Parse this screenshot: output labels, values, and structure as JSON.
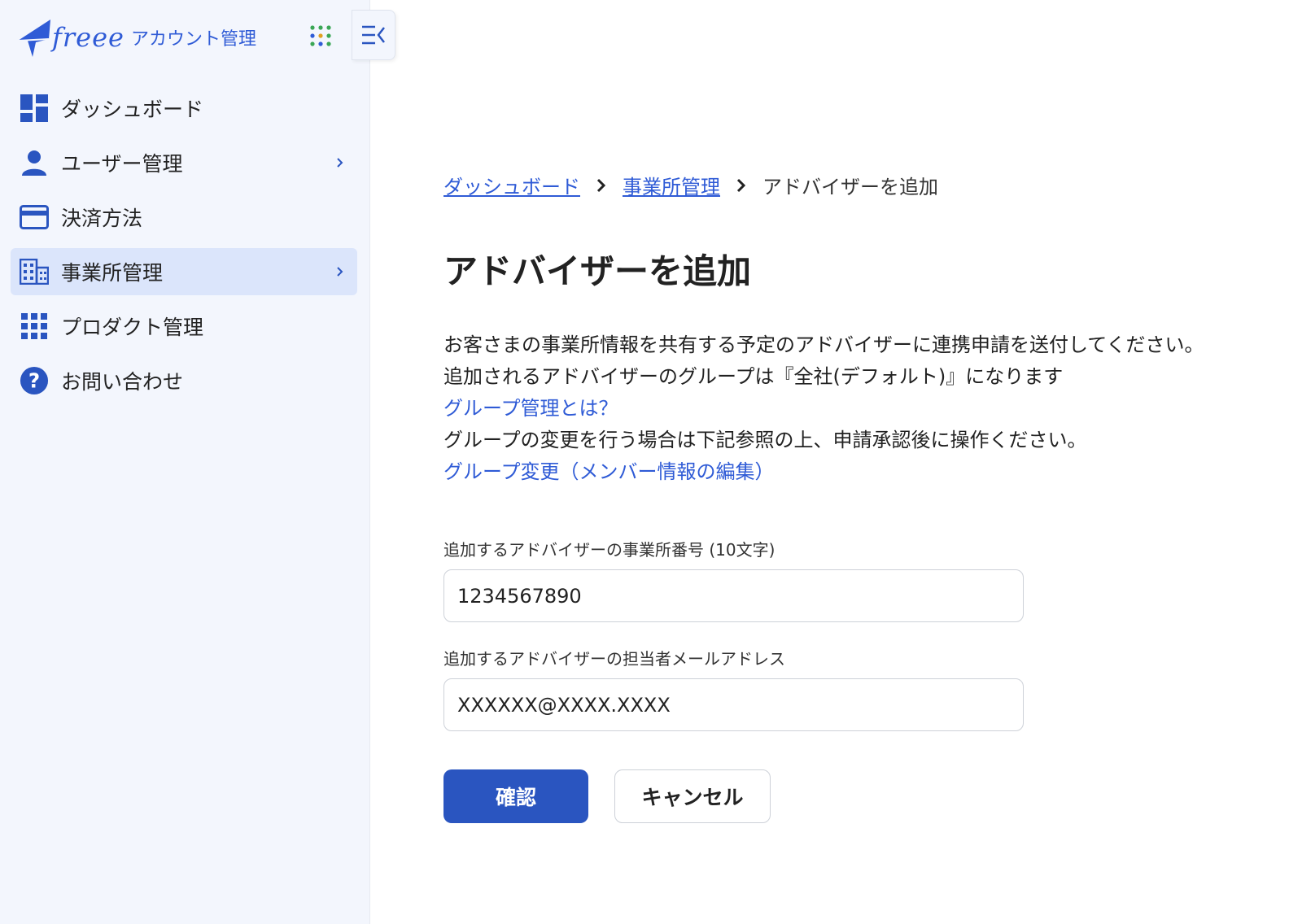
{
  "sidebar": {
    "logo_text": "freee",
    "logo_sub": "アカウント管理",
    "apps_icon": "grid-dots-icon",
    "collapse_icon": "collapse-menu-icon",
    "items": [
      {
        "label": "ダッシュボード",
        "icon": "dashboard-icon",
        "active": false,
        "has_chevron": false
      },
      {
        "label": "ユーザー管理",
        "icon": "user-icon",
        "active": false,
        "has_chevron": true
      },
      {
        "label": "決済方法",
        "icon": "credit-card-icon",
        "active": false,
        "has_chevron": false
      },
      {
        "label": "事業所管理",
        "icon": "building-icon",
        "active": true,
        "has_chevron": true
      },
      {
        "label": "プロダクト管理",
        "icon": "grid-icon",
        "active": false,
        "has_chevron": false
      },
      {
        "label": "お問い合わせ",
        "icon": "help-icon",
        "active": false,
        "has_chevron": false
      }
    ]
  },
  "breadcrumb": {
    "items": [
      "ダッシュボード",
      "事業所管理"
    ],
    "current": "アドバイザーを追加"
  },
  "page": {
    "title": "アドバイザーを追加",
    "desc_line1": "お客さまの事業所情報を共有する予定のアドバイザーに連携申請を送付してください。",
    "desc_line2": "追加されるアドバイザーのグループは『全社(デフォルト)』になります",
    "link_group_about": "グループ管理とは？",
    "desc_line3": "グループの変更を行う場合は下記参照の上、申請承認後に操作ください。",
    "link_group_change": "グループ変更（メンバー情報の編集）"
  },
  "form": {
    "office_number_label": "追加するアドバイザーの事業所番号 (10文字)",
    "office_number_value": "1234567890",
    "email_label": "追加するアドバイザーの担当者メールアドレス",
    "email_value": "XXXXXX@XXXX.XXXX",
    "confirm_label": "確認",
    "cancel_label": "キャンセル"
  },
  "colors": {
    "accent": "#2f5bd6",
    "primary_button": "#2a55c0",
    "sidebar_bg": "#f3f6fd",
    "active_item_bg": "#dbe5fb"
  }
}
